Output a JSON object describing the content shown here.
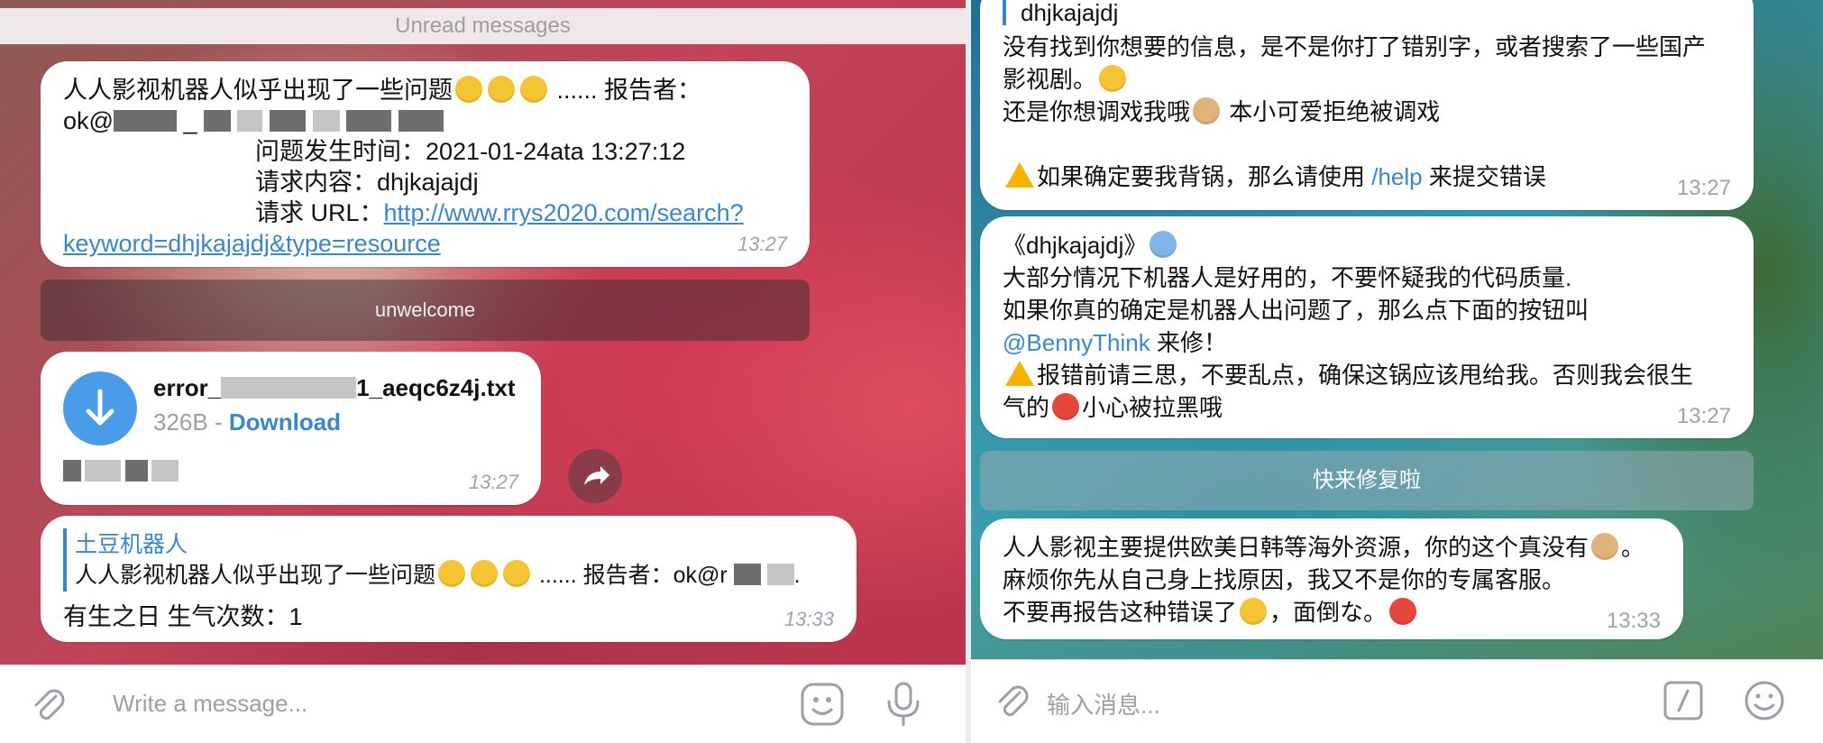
{
  "left": {
    "unread_label": "Unread messages",
    "msg1": {
      "line1": "人人影视机器人似乎出现了一些问题",
      "line1_tail": "...... 报告者：",
      "reporter_prefix": "ok@",
      "time_line": "问题发生时间：2021-01-24ata 13:27:12",
      "content_line": "请求内容：dhjkajajdj",
      "url_label": "请求 URL：",
      "url_part1": "http://www.rrys2020.com/search?",
      "url_part2": "keyword=dhjkajajdj&type=resource",
      "time": "13:27"
    },
    "unwelcome_label": "unwelcome",
    "file": {
      "name_prefix": "error_",
      "name_suffix": "1_aeqc6z4j.txt",
      "size": "326B",
      "sep": " - ",
      "download": "Download",
      "time": "13:27"
    },
    "msg3": {
      "reply_author": "土豆机器人",
      "reply_text": "人人影视机器人似乎出现了一些问题",
      "reply_tail": "...... 报告者：ok@r",
      "text": "有生之日 生气次数：1",
      "time": "13:33"
    },
    "input_placeholder": "Write a message..."
  },
  "right": {
    "msg1": {
      "reply_text": "dhjkajajdj",
      "line1": "没有找到你想要的信息，是不是你打了错别字，或者搜索了一些国产",
      "line2": "影视剧。",
      "line3a": "还是你想调戏我哦",
      "line3b": "本小可爱拒绝被调戏",
      "line4a": "如果确定要我背锅，那么请使用",
      "help": "/help",
      "line4b": "来提交错误",
      "time": "13:27"
    },
    "msg2": {
      "line1": "《dhjkajajdj》",
      "line2": "大部分情况下机器人是好用的，不要怀疑我的代码质量.",
      "line3": "如果你真的确定是机器人出问题了，那么点下面的按钮叫",
      "mention": "@BennyThink",
      "line4b": "来修！",
      "line5": "报错前请三思，不要乱点，确保这锅应该甩给我。否则我会很生",
      "line6a": "气的",
      "line6b": "小心被拉黑哦",
      "time": "13:27"
    },
    "button_label": "快来修复啦",
    "msg3": {
      "line1": "人人影视主要提供欧美日韩等海外资源，你的这个真没有",
      "line1_end": "。",
      "line2": "麻烦你先从自己身上找原因，我又不是你的专属客服。",
      "line3a": "不要再报告这种错误了",
      "line3b": "，面倒な。",
      "time": "13:33"
    },
    "input_placeholder": "输入消息..."
  },
  "colors": {
    "link": "#3d86c4",
    "download_circle": "#4a9be8",
    "timestamp": "#9aa5ad"
  },
  "icons": [
    "paperclip-icon",
    "sticker-icon",
    "microphone-icon",
    "download-arrow-icon",
    "forward-icon",
    "bot-command-icon",
    "emoji-icon"
  ]
}
